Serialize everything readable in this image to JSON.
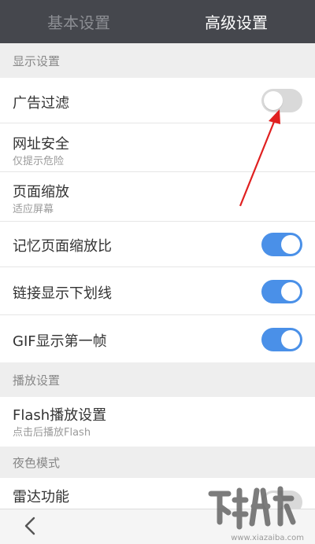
{
  "tabs": [
    {
      "label": "基本设置",
      "active": false
    },
    {
      "label": "高级设置",
      "active": true
    }
  ],
  "sections": {
    "display": "显示设置",
    "playback": "播放设置",
    "night": "夜色模式"
  },
  "rows": {
    "ad_filter": {
      "title": "广告过滤",
      "toggle": "off"
    },
    "url_security": {
      "title": "网址安全",
      "subtitle": "仅提示危险"
    },
    "page_zoom": {
      "title": "页面缩放",
      "subtitle": "适应屏幕"
    },
    "remember_zoom": {
      "title": "记忆页面缩放比",
      "toggle": "on"
    },
    "link_underline": {
      "title": "链接显示下划线",
      "toggle": "on"
    },
    "gif_first_frame": {
      "title": "GIF显示第一帧",
      "toggle": "on"
    },
    "flash": {
      "title": "Flash播放设置",
      "subtitle": "点击后播放Flash"
    },
    "radar": {
      "title": "雷达功能"
    }
  },
  "watermark": {
    "text": "www.xiazaiba.com"
  },
  "colors": {
    "accent": "#4a90e8",
    "tabbar": "#45474d",
    "annotation": "#e02020"
  }
}
